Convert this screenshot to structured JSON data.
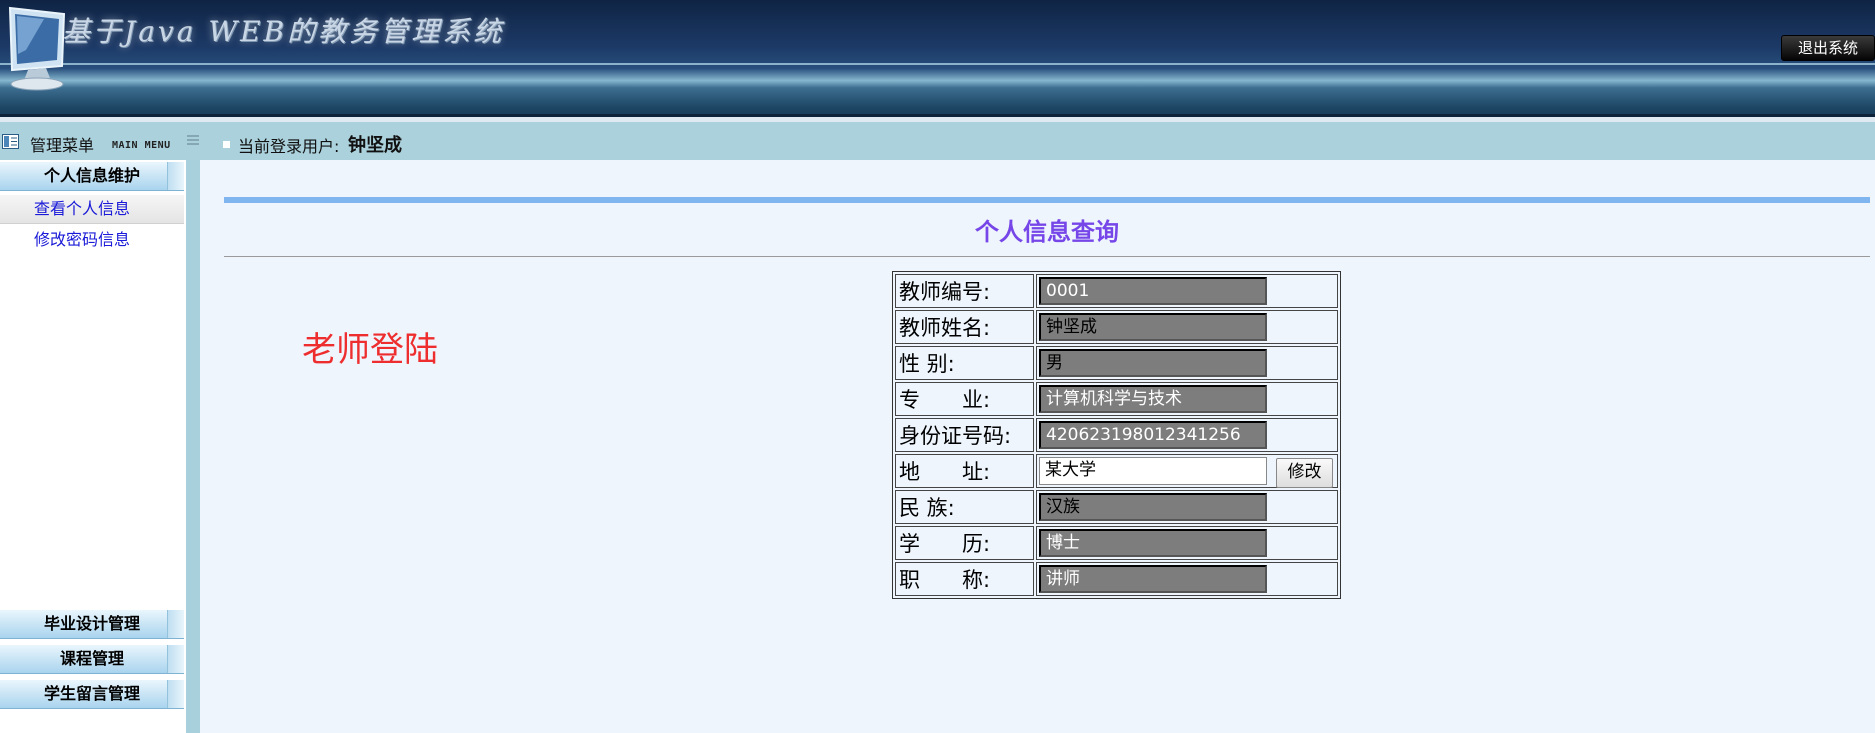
{
  "header": {
    "site_title": "基于Java WEB的教务管理系统",
    "logout_label": "退出系统"
  },
  "toolbar": {
    "menu_label": "管理菜单",
    "menu_label_en": "MAIN MENU",
    "login_label": "当前登录用户:",
    "login_user": "钟坚成"
  },
  "sidebar": {
    "groups": [
      {
        "title": "个人信息维护",
        "items": [
          {
            "label": "查看个人信息"
          },
          {
            "label": "修改密码信息"
          }
        ]
      },
      {
        "title": "毕业设计管理"
      },
      {
        "title": "课程管理"
      },
      {
        "title": "学生留言管理"
      }
    ]
  },
  "main": {
    "page_title": "个人信息查询",
    "note": "老师登陆",
    "fields": [
      {
        "label": "教师编号:",
        "value": "0001"
      },
      {
        "label": "教师姓名:",
        "value": "钟坚成"
      },
      {
        "label": "性 别:",
        "value": "男"
      },
      {
        "label": "专　　业:",
        "value": "计算机科学与技术"
      },
      {
        "label": "身份证号码:",
        "value": "420623198012341256"
      },
      {
        "label": "地　　址:",
        "value": "某大学"
      },
      {
        "label": "民 族:",
        "value": "汉族"
      },
      {
        "label": "学　　历:",
        "value": "博士"
      },
      {
        "label": "职　　称:",
        "value": "讲师"
      }
    ],
    "modify_label": "修改"
  }
}
